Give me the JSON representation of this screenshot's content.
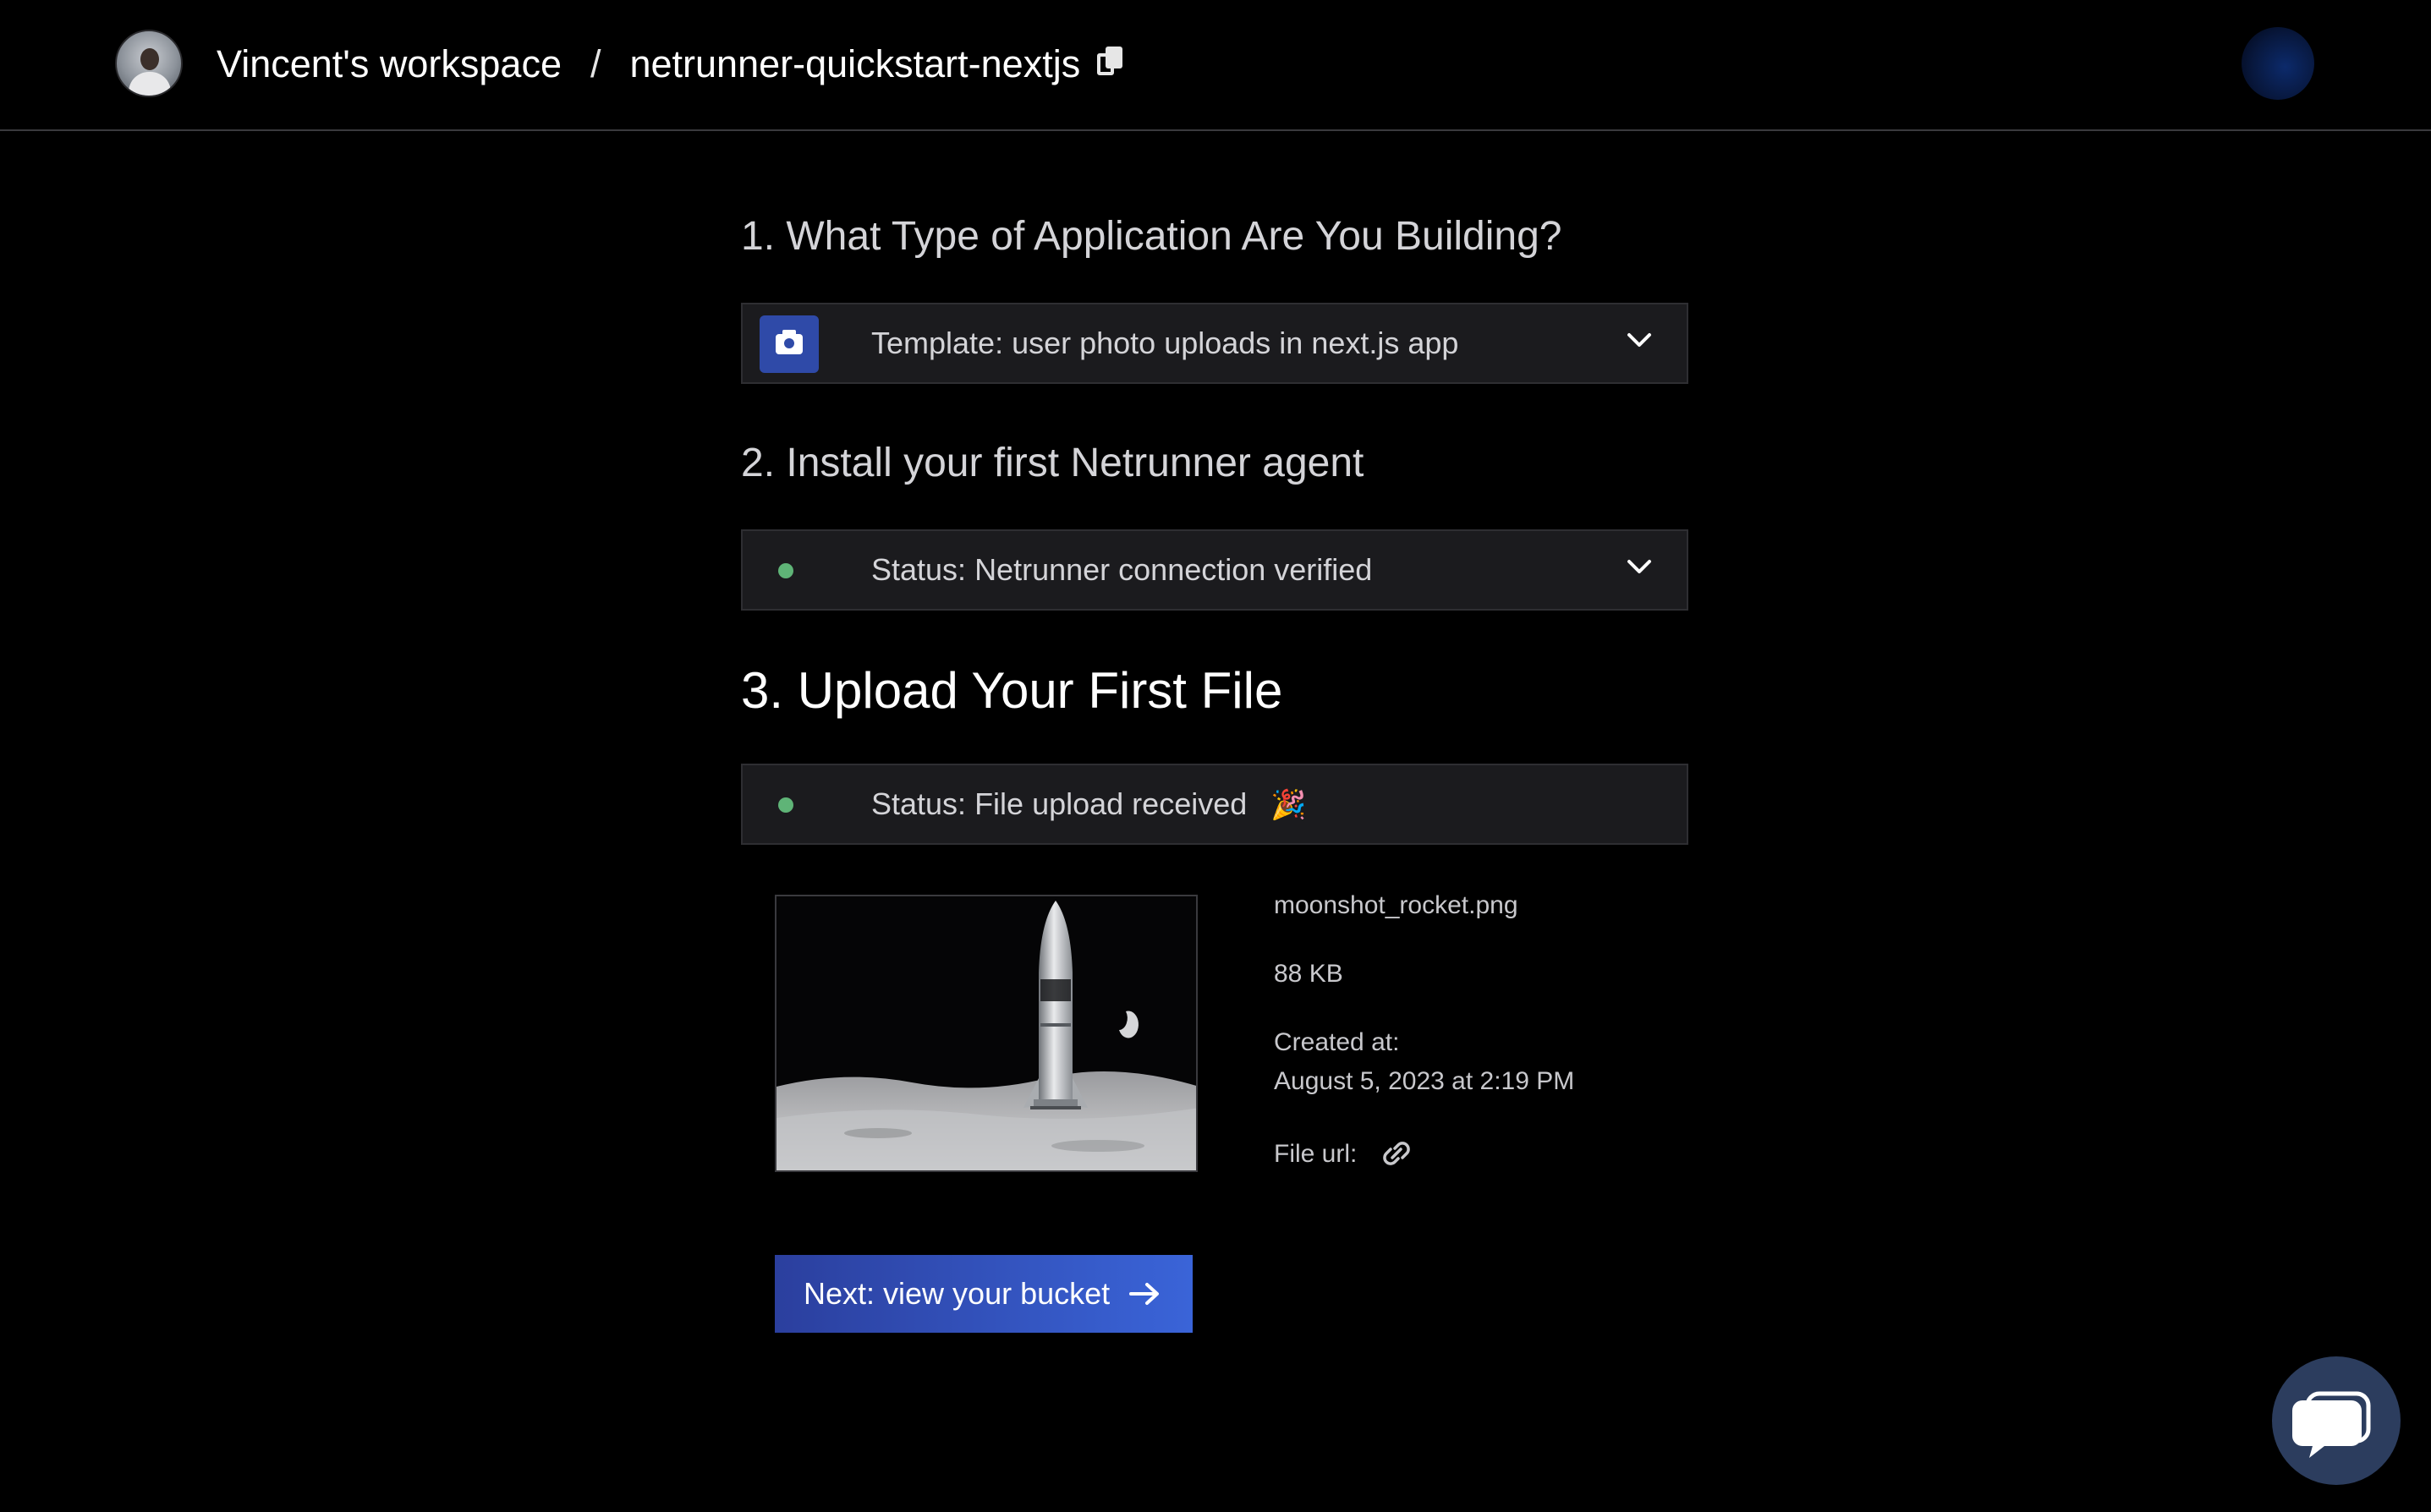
{
  "header": {
    "workspace": "Vincent's workspace",
    "separator": "/",
    "project": "netrunner-quickstart-nextjs"
  },
  "steps": {
    "step1": {
      "title": "1. What Type of Application Are You Building?",
      "selection": "Template: user photo uploads in next.js app"
    },
    "step2": {
      "title": "2. Install your first Netrunner agent",
      "status": "Status: Netrunner connection verified"
    },
    "step3": {
      "title": "3. Upload Your First File",
      "status": "Status: File upload received",
      "status_emoji": "🎉"
    }
  },
  "file": {
    "name": "moonshot_rocket.png",
    "size": "88 KB",
    "created_label": "Created at:",
    "created_value": "August 5, 2023 at 2:19 PM",
    "url_label": "File url:"
  },
  "cta": {
    "label": "Next: view your bucket"
  },
  "colors": {
    "accent": "#3a64d8",
    "status_ok": "#5fb477",
    "background": "#000000",
    "panel": "#1b1b1e"
  },
  "icons": {
    "copy": "copy-icon",
    "camera": "camera-icon",
    "chevron": "chevron-down-icon",
    "link": "link-icon",
    "arrow": "arrow-right-icon",
    "chat": "chat-icon"
  }
}
